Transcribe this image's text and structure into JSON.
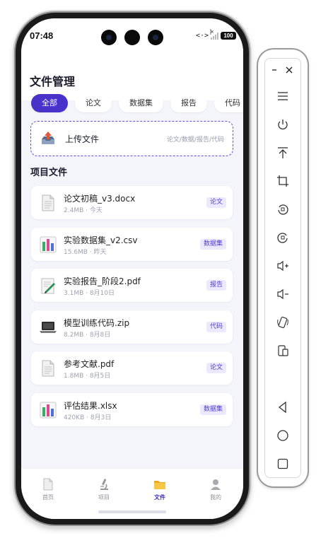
{
  "status_bar": {
    "time": "07:48",
    "battery": "100"
  },
  "header": {
    "title": "文件管理"
  },
  "tabs": [
    {
      "label": "全部",
      "active": true
    },
    {
      "label": "论文",
      "active": false
    },
    {
      "label": "数据集",
      "active": false
    },
    {
      "label": "报告",
      "active": false
    },
    {
      "label": "代码",
      "active": false
    }
  ],
  "upload": {
    "label": "上传文件",
    "hint": "论文/数据/报告/代码",
    "icon": "upload-tray-icon"
  },
  "section_title": "项目文件",
  "files": [
    {
      "name": "论文初稿_v3.docx",
      "meta": "2.4MB · 今天",
      "tag": "论文",
      "icon": "document-icon"
    },
    {
      "name": "实验数据集_v2.csv",
      "meta": "15.6MB · 昨天",
      "tag": "数据集",
      "icon": "bar-chart-icon"
    },
    {
      "name": "实验报告_阶段2.pdf",
      "meta": "3.1MB · 8月10日",
      "tag": "报告",
      "icon": "memo-icon"
    },
    {
      "name": "模型训练代码.zip",
      "meta": "8.2MB · 8月8日",
      "tag": "代码",
      "icon": "laptop-icon"
    },
    {
      "name": "参考文献.pdf",
      "meta": "1.8MB · 8月5日",
      "tag": "论文",
      "icon": "document-icon"
    },
    {
      "name": "评估结果.xlsx",
      "meta": "420KB · 8月3日",
      "tag": "数据集",
      "icon": "bar-chart-icon"
    }
  ],
  "bottom_nav": [
    {
      "label": "首页",
      "icon": "page-icon",
      "active": false
    },
    {
      "label": "项目",
      "icon": "microscope-icon",
      "active": false
    },
    {
      "label": "文件",
      "icon": "folder-icon",
      "active": true
    },
    {
      "label": "我的",
      "icon": "user-icon",
      "active": false
    }
  ],
  "colors": {
    "accent": "#4733c9",
    "tag_bg": "#ece9ff",
    "page_bg": "#f4f4fb"
  },
  "emulator_toolbar": {
    "window_controls": [
      "minimize-icon",
      "close-icon"
    ],
    "buttons": [
      "menu-icon",
      "power-icon",
      "pin-to-top-icon",
      "crop-icon",
      "rotate-left-icon",
      "rotate-right-icon",
      "volume-up-icon",
      "volume-down-icon",
      "shake-icon",
      "screenshot-icon",
      "back-icon",
      "home-icon",
      "recents-icon"
    ]
  }
}
